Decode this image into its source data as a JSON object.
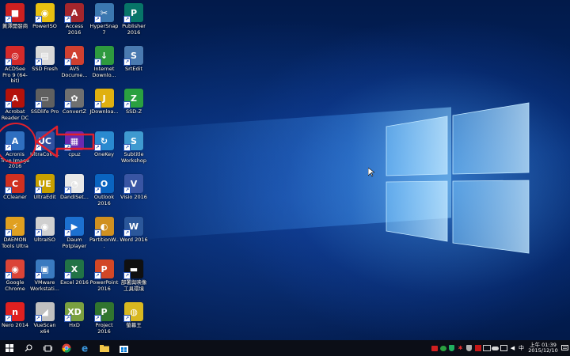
{
  "desktop": {
    "icons": [
      {
        "label": "黃澤開發商",
        "color": "#cc2020",
        "glyph": "■"
      },
      {
        "label": "PowerISO",
        "color": "#e8c010",
        "glyph": "◉"
      },
      {
        "label": "Access 2016",
        "color": "#a4262c",
        "glyph": "A"
      },
      {
        "label": "HyperSnap 7",
        "color": "#3b78b0",
        "glyph": "✂"
      },
      {
        "label": "Publisher 2016",
        "color": "#077568",
        "glyph": "P"
      },
      {
        "label": "ACDSee Pro 9 (64-bit)",
        "color": "#d42a2a",
        "glyph": "◎"
      },
      {
        "label": "SSD Fresh",
        "color": "#d8d8d8",
        "glyph": "▤"
      },
      {
        "label": "AVS Docume...",
        "color": "#d04030",
        "glyph": "A"
      },
      {
        "label": "Internet Downlo...",
        "color": "#2e9a3e",
        "glyph": "↓"
      },
      {
        "label": "SrtEdit",
        "color": "#4a7ab0",
        "glyph": "S"
      },
      {
        "label": "Acrobat Reader DC",
        "color": "#b3120b",
        "glyph": "A"
      },
      {
        "label": "SSDlife Pro",
        "color": "#606060",
        "glyph": "▭"
      },
      {
        "label": "ConvertZ",
        "color": "#707070",
        "glyph": "✿"
      },
      {
        "label": "JDownloa...",
        "color": "#e0b010",
        "glyph": "J"
      },
      {
        "label": "SSD-Z",
        "color": "#2aa040",
        "glyph": "Z"
      },
      {
        "label": "Acronis True Image 2016",
        "color": "#2f6fc0",
        "glyph": "A"
      },
      {
        "label": "UltraCom...",
        "color": "#3050a0",
        "glyph": "UC"
      },
      {
        "label": "cpuz",
        "color": "#6a2ab0",
        "glyph": "▦"
      },
      {
        "label": "OneKey",
        "color": "#2a8ad0",
        "glyph": "↻"
      },
      {
        "label": "Subtitle Workshop",
        "color": "#3f9ad0",
        "glyph": "S"
      },
      {
        "label": "CCleaner",
        "color": "#d03020",
        "glyph": "C"
      },
      {
        "label": "UltraEdit",
        "color": "#c8a000",
        "glyph": "UE"
      },
      {
        "label": "DandiSet...",
        "color": "#e8e8e8",
        "glyph": "◔"
      },
      {
        "label": "Outlook 2016",
        "color": "#0a64c0",
        "glyph": "O"
      },
      {
        "label": "Visio 2016",
        "color": "#3955a3",
        "glyph": "V"
      },
      {
        "label": "DAEMON Tools Ultra",
        "color": "#e0a020",
        "glyph": "⚡"
      },
      {
        "label": "UltraISO",
        "color": "#d0d0d0",
        "glyph": "◉"
      },
      {
        "label": "Daum Potplayer",
        "color": "#1c70d0",
        "glyph": "▶"
      },
      {
        "label": "PartitionW...",
        "color": "#d09020",
        "glyph": "◐"
      },
      {
        "label": "Word 2016",
        "color": "#2b579a",
        "glyph": "W"
      },
      {
        "label": "Google Chrome",
        "color": "#db4437",
        "glyph": "◉"
      },
      {
        "label": "VMware Workstati...",
        "color": "#3a7ac0",
        "glyph": "▣"
      },
      {
        "label": "Excel 2016",
        "color": "#217346",
        "glyph": "X"
      },
      {
        "label": "PowerPoint 2016",
        "color": "#d24726",
        "glyph": "P"
      },
      {
        "label": "部署與映像工具環境",
        "color": "#101010",
        "glyph": "▬"
      },
      {
        "label": "Nero 2014",
        "color": "#e02020",
        "glyph": "n"
      },
      {
        "label": "VueScan x64",
        "color": "#c0c0c0",
        "glyph": "◢"
      },
      {
        "label": "HxD",
        "color": "#7aa040",
        "glyph": "XD"
      },
      {
        "label": "Project 2016",
        "color": "#31752f",
        "glyph": "P"
      },
      {
        "label": "螢幕王",
        "color": "#d8b820",
        "glyph": "◍"
      }
    ]
  },
  "taskbar": {
    "clock_line1": "上午 01:39",
    "clock_line2": "2015/12/10",
    "ime": "中",
    "colors": {
      "background": "#0b0e17",
      "highlight": "#e0202c"
    }
  }
}
